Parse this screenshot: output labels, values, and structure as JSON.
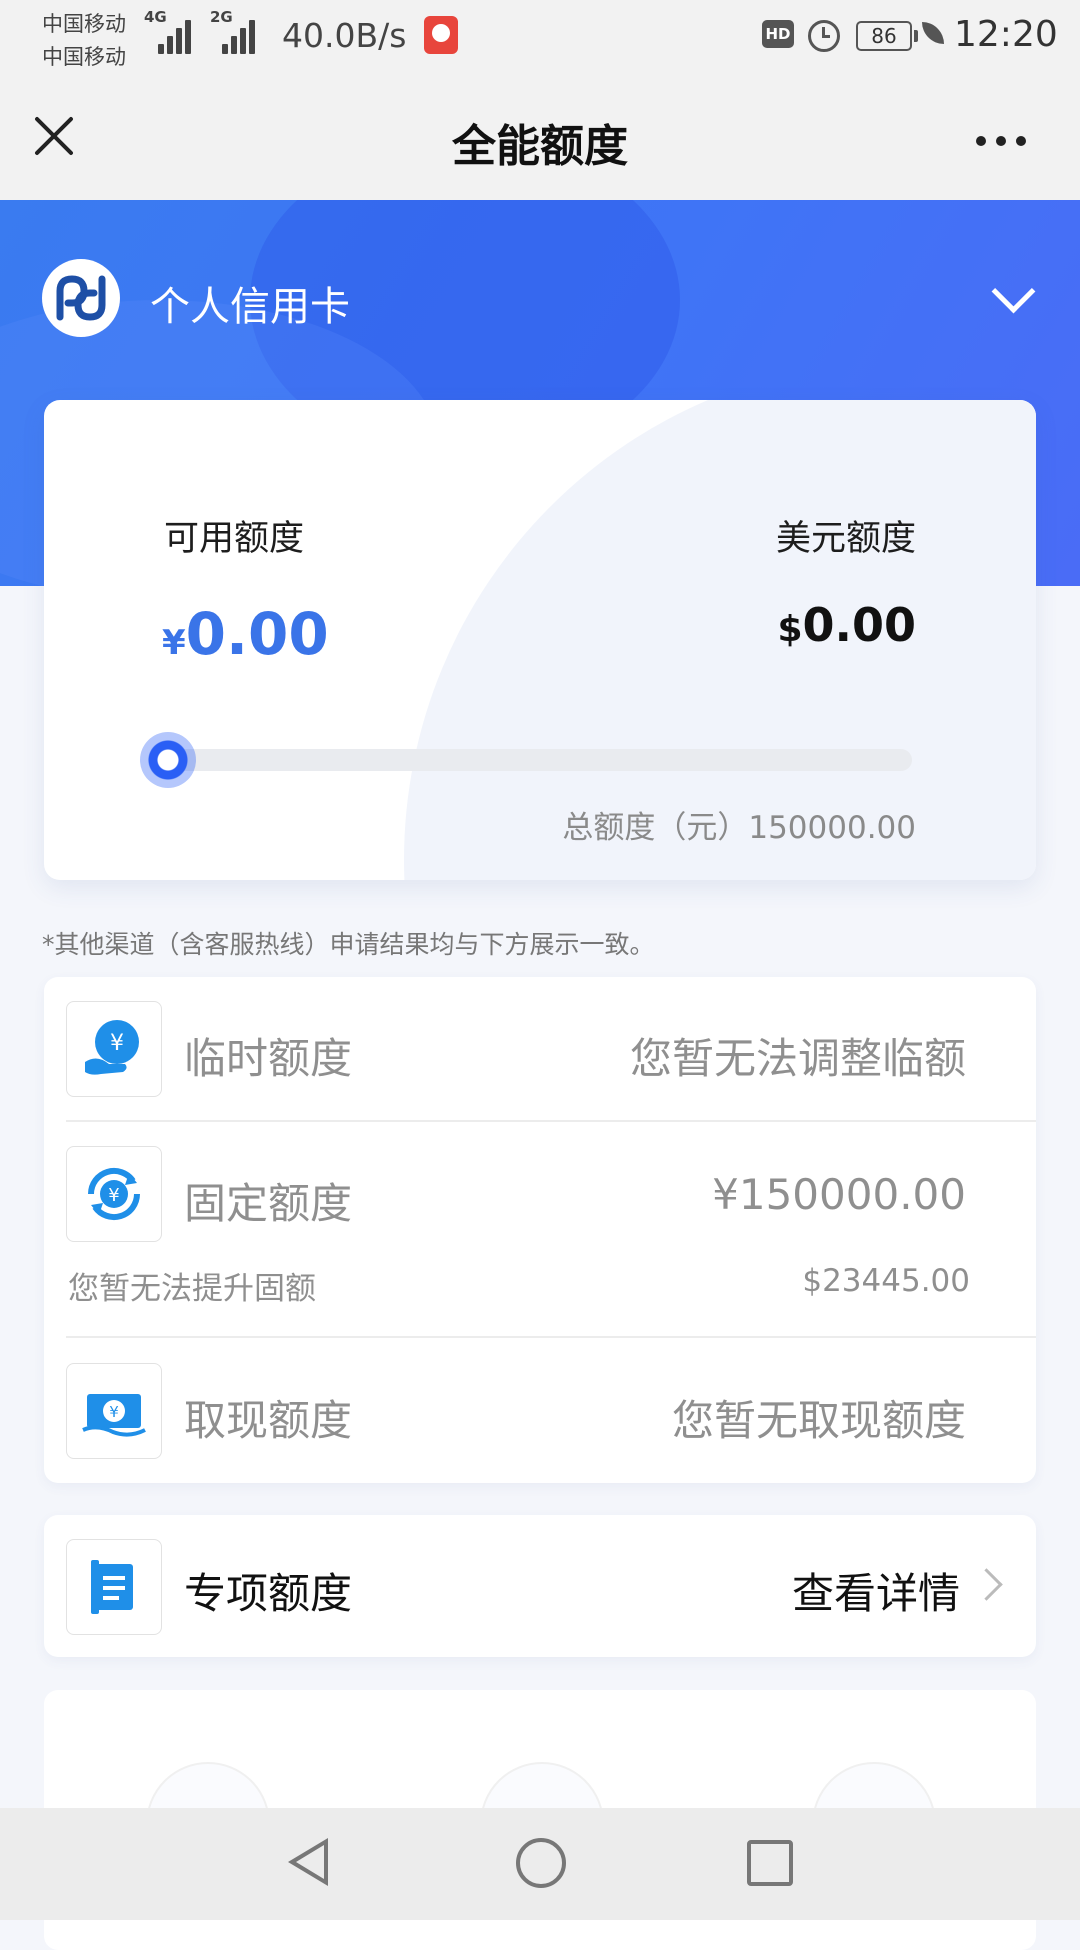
{
  "status_bar": {
    "carrier1": "中国移动",
    "carrier2": "中国移动",
    "net1": "4G",
    "net2": "2G",
    "speed": "40.0B/s",
    "hd": "HD",
    "battery": "86",
    "time": "12:20"
  },
  "nav": {
    "title": "全能额度"
  },
  "card_selector": {
    "label": "个人信用卡"
  },
  "quota": {
    "available_label": "可用额度",
    "available_currency": "¥",
    "available_amount": "0.00",
    "usd_label": "美元额度",
    "usd_currency": "$",
    "usd_amount": "0.00",
    "total_text": "总额度（元）150000.00",
    "usage_fraction": 0
  },
  "notice": "*其他渠道（含客服热线）申请结果均与下方展示一致。",
  "items": [
    {
      "title": "临时额度",
      "value": "您暂无法调整临额"
    },
    {
      "title": "固定额度",
      "value": "¥150000.00",
      "sub": "您暂无法提升固额",
      "subvalue": "$23445.00"
    },
    {
      "title": "取现额度",
      "value": "您暂无取现额度"
    }
  ],
  "special": {
    "title": "专项额度",
    "link": "查看详情"
  },
  "colors": {
    "brand_blue": "#3a74e8",
    "hero_blue": "#3f74f6",
    "muted_text": "#8f8f8f"
  },
  "icons": [
    "close-icon",
    "more-icon",
    "chevron-down-icon",
    "temp-quota-icon",
    "fixed-quota-icon",
    "cash-quota-icon",
    "special-quota-icon",
    "chevron-right-icon"
  ]
}
